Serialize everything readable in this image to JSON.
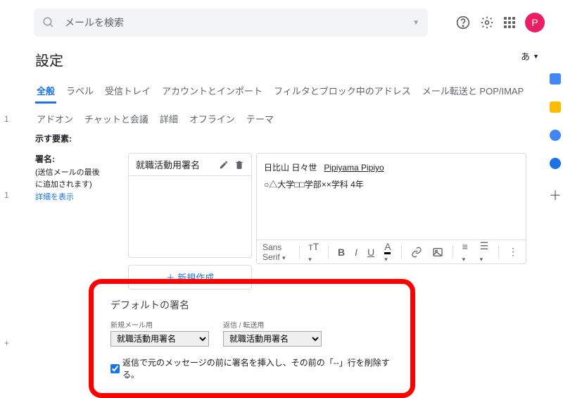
{
  "search": {
    "placeholder": "メールを検索"
  },
  "avatar_initial": "P",
  "page_title": "設定",
  "lang_button": "あ",
  "tabs": [
    "全般",
    "ラベル",
    "受信トレイ",
    "アカウントとインポート",
    "フィルタとブロック中のアドレス",
    "メール転送と POP/IMAP",
    "アドオン",
    "チャットと会議",
    "詳細",
    "オフライン",
    "テーマ"
  ],
  "show_label": "示す要素:",
  "signature": {
    "heading": "署名:",
    "note1": "(送信メールの最後",
    "note2": "に追加されます)",
    "learn_more": "詳細を表示",
    "item_name": "就職活動用署名",
    "new_button": "＋ 新規作成",
    "editor": {
      "line1": "日比山 日々世",
      "line1_roman": "Pipiyama Pipiyo",
      "line2": "○△大学□□学部××学科 4年"
    },
    "toolbar_font": "Sans Serif"
  },
  "defaults": {
    "title": "デフォルトの署名",
    "col1_label": "新規メール用",
    "col2_label": "返信 / 転送用",
    "select_value": "就職活動用署名",
    "checkbox_label": "返信で元のメッセージの前に署名を挿入し、その前の「--」行を削除する。"
  },
  "left_numbers": [
    "1",
    "1",
    "+"
  ]
}
